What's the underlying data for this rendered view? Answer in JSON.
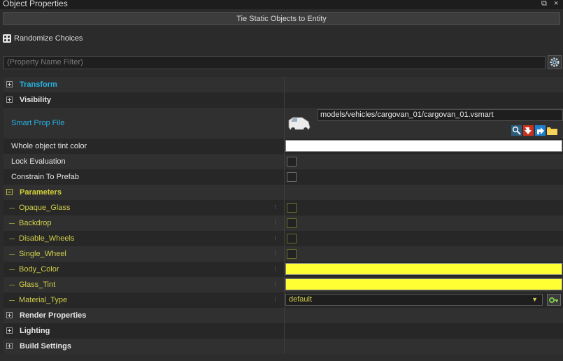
{
  "window": {
    "title": "Object Properties",
    "restore_glyph": "⧉",
    "close_glyph": "×"
  },
  "buttons": {
    "tie_static": "Tie Static Objects to Entity",
    "randomize": "Randomize Choices"
  },
  "filter": {
    "placeholder": "(Property Name Filter)",
    "settings_icon": "gear-icon"
  },
  "categories": {
    "transform": "Transform",
    "visibility": "Visibility",
    "parameters": "Parameters",
    "render_properties": "Render Properties",
    "lighting": "Lighting",
    "build_settings": "Build Settings"
  },
  "properties": {
    "smart_prop_file": {
      "label": "Smart Prop File",
      "value": "models/vehicles/cargovan_01/cargovan_01.vsmart"
    },
    "tint": {
      "label": "Whole object tint color",
      "color": "#ffffff"
    },
    "lock_evaluation": {
      "label": "Lock Evaluation",
      "checked": false
    },
    "constrain_prefab": {
      "label": "Constrain To Prefab",
      "checked": false
    }
  },
  "parameters": {
    "opaque_glass": {
      "label": "Opaque_Glass",
      "checked": false
    },
    "backdrop": {
      "label": "Backdrop",
      "checked": false
    },
    "disable_wheels": {
      "label": "Disable_Wheels",
      "checked": false
    },
    "single_wheel": {
      "label": "Single_Wheel",
      "checked": false
    },
    "body_color": {
      "label": "Body_Color",
      "color": "#ffff33"
    },
    "glass_tint": {
      "label": "Glass_Tint",
      "color": "#ffff33"
    },
    "material_type": {
      "label": "Material_Type",
      "value": "default"
    }
  },
  "colors": {
    "accent_blue": "#27b2e3",
    "param_yellow": "#d0ce4a",
    "background": "#2b2b2b"
  }
}
